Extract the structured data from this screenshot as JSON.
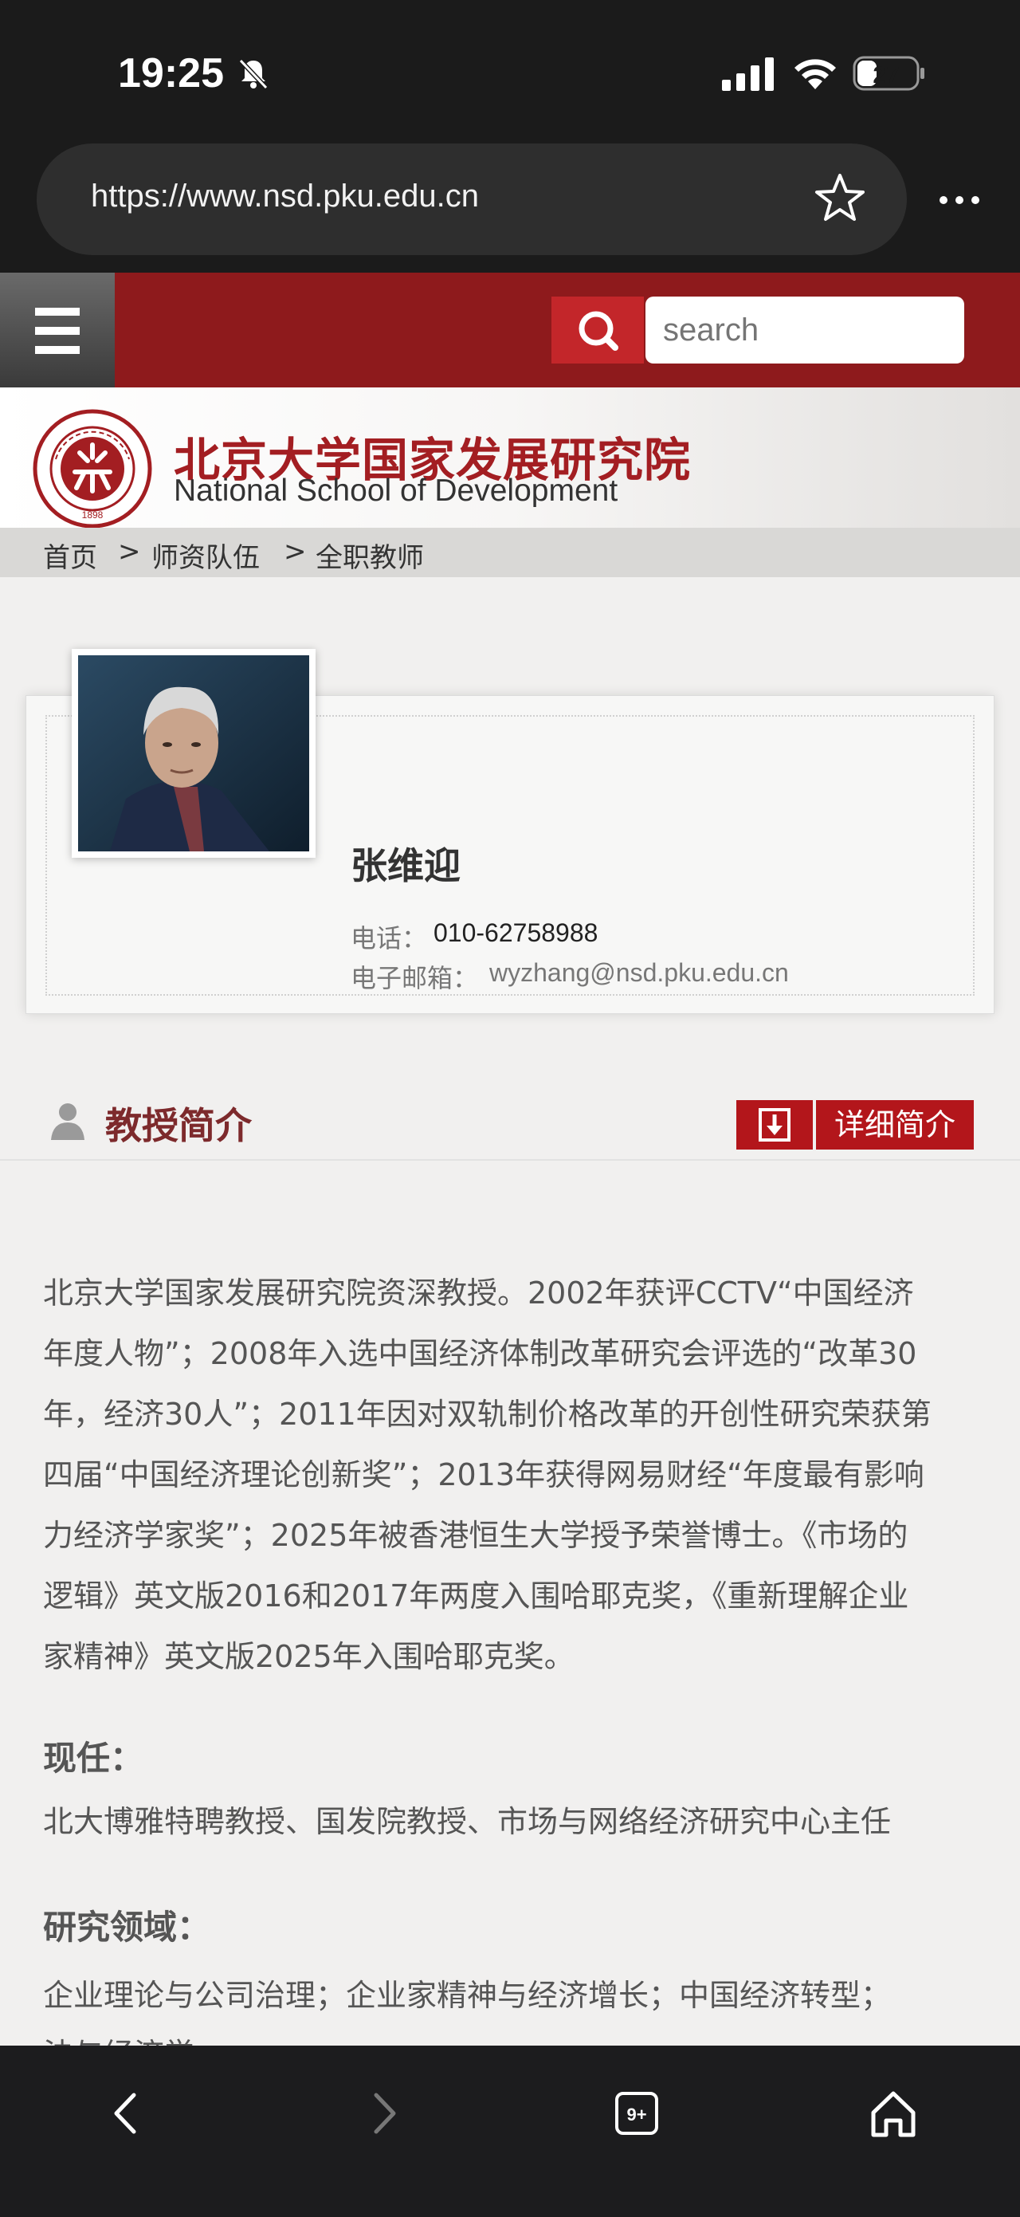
{
  "status_bar": {
    "time": "19:25",
    "battery": "27"
  },
  "browser": {
    "url": "https://www.nsd.pku.edu.cn",
    "tabs_count": "9+"
  },
  "site": {
    "search_placeholder": "search",
    "name_cn": "北京大学国家发展研究院",
    "name_en": "National School of Development"
  },
  "breadcrumb": [
    "首页",
    ">",
    "师资队伍",
    ">",
    "全职教师"
  ],
  "profile": {
    "name": "张维迎",
    "phone_label": "电话：",
    "phone": "010-62758988",
    "email_label": "电子邮箱：",
    "email": "wyzhang@nsd.pku.edu.cn"
  },
  "section": {
    "title": "教授简介",
    "detail_button": "详细简介"
  },
  "bio_lines": [
    "北京大学国家发展研究院资深教授。2002年获评CCTV“中国经济",
    "年度人物”；2008年入选中国经济体制改革研究会评选的“改革30",
    "年，经济30人”；2011年因对双轨制价格改革的开创性研究荣获第",
    "四届“中国经济理论创新奖”；2013年获得网易财经“年度最有影响",
    "力经济学家奖”；2025年被香港恒生大学授予荣誉博士。《市场的",
    "逻辑》英文版2016和2017年两度入围哈耶克奖，《重新理解企业",
    "家精神》英文版2025年入围哈耶克奖。"
  ],
  "current": {
    "heading": "现任：",
    "text": "北大博雅特聘教授、国发院教授、市场与网络经济研究中心主任"
  },
  "research": {
    "heading": "研究领域：",
    "line1": "企业理论与公司治理；企业家精神与经济增长；中国经济转型；",
    "line2": "法与经济学"
  },
  "icons": [
    "bell-slash-icon",
    "signal-icon",
    "wifi-icon",
    "battery-icon",
    "star-icon",
    "more-icon",
    "menu-icon",
    "search-icon",
    "person-icon",
    "download-icon",
    "back-icon",
    "forward-icon",
    "tabs-icon",
    "home-icon"
  ],
  "colors": {
    "brand_red": "#8e1a1c",
    "button_red": "#b3161b",
    "title_red": "#a31e22"
  }
}
